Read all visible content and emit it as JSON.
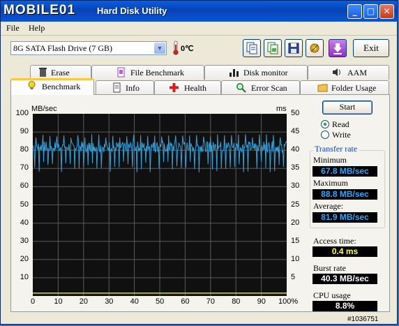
{
  "window": {
    "logo_text": "MOBILE01",
    "title": "Hard Disk Utility",
    "controls": {
      "minimize": "_",
      "maximize": "□",
      "close": "✕"
    }
  },
  "menu": {
    "file": "File",
    "help": "Help"
  },
  "toolbar": {
    "drive": "8G SATA Flash Drive (7 GB)",
    "temperature": "0℃",
    "exit_label": "Exit",
    "buttons": [
      "copy-info-icon",
      "copy-screenshot-icon",
      "save-icon",
      "options-icon",
      "download-icon"
    ]
  },
  "tabs_back": [
    {
      "label": "Erase",
      "icon": "trash-icon"
    },
    {
      "label": "File Benchmark",
      "icon": "file-icon"
    },
    {
      "label": "Disk monitor",
      "icon": "bar-chart-icon"
    },
    {
      "label": "AAM",
      "icon": "speaker-icon"
    }
  ],
  "tabs_front": [
    {
      "label": "Benchmark",
      "icon": "bulb-icon",
      "active": true
    },
    {
      "label": "Info",
      "icon": "info-icon"
    },
    {
      "label": "Health",
      "icon": "health-cross-icon"
    },
    {
      "label": "Error Scan",
      "icon": "magnifier-icon"
    },
    {
      "label": "Folder Usage",
      "icon": "folder-icon"
    }
  ],
  "controls": {
    "start_label": "Start",
    "read_label": "Read",
    "write_label": "Write",
    "selected_mode": "Read"
  },
  "stats": {
    "transfer_rate_title": "Transfer rate",
    "minimum_label": "Minimum",
    "minimum_value": "67.8 MB/sec",
    "maximum_label": "Maximum",
    "maximum_value": "88.8 MB/sec",
    "average_label": "Average:",
    "average_value": "81.9 MB/sec",
    "access_time_label": "Access time:",
    "access_time_value": "0.4 ms",
    "burst_rate_label": "Burst rate",
    "burst_rate_value": "40.3 MB/sec",
    "cpu_usage_label": "CPU usage",
    "cpu_usage_value": "8.8%"
  },
  "watermark": "#1036751",
  "colors": {
    "value_blue": "#29a8ff",
    "value_yellow": "#ffff40",
    "value_white": "#ffffff",
    "trace": "#31a5e0",
    "access": "#e0e000",
    "plot_bg": "#101010"
  },
  "chart_data": {
    "type": "line",
    "left_axis_label": "MB/sec",
    "right_axis_label": "ms",
    "x_ticks": [
      "0",
      "10",
      "20",
      "30",
      "40",
      "50",
      "60",
      "70",
      "80",
      "90",
      "100%"
    ],
    "y_ticks_left": [
      "100",
      "90",
      "80",
      "70",
      "60",
      "50",
      "40",
      "30",
      "20",
      "10"
    ],
    "y_ticks_right": [
      "50",
      "45",
      "40",
      "35",
      "30",
      "25",
      "20",
      "15",
      "10",
      "5"
    ],
    "xlim": [
      0,
      100
    ],
    "ylim_left": [
      0,
      100
    ],
    "ylim_right": [
      0,
      50
    ],
    "grid": true,
    "series": [
      {
        "name": "Read",
        "axis": "left",
        "x_start": 0,
        "x_end": 100,
        "min": 67.8,
        "max": 88.8,
        "mean": 81.9
      },
      {
        "name": "Access time",
        "axis": "right",
        "value": 0.4
      }
    ]
  }
}
